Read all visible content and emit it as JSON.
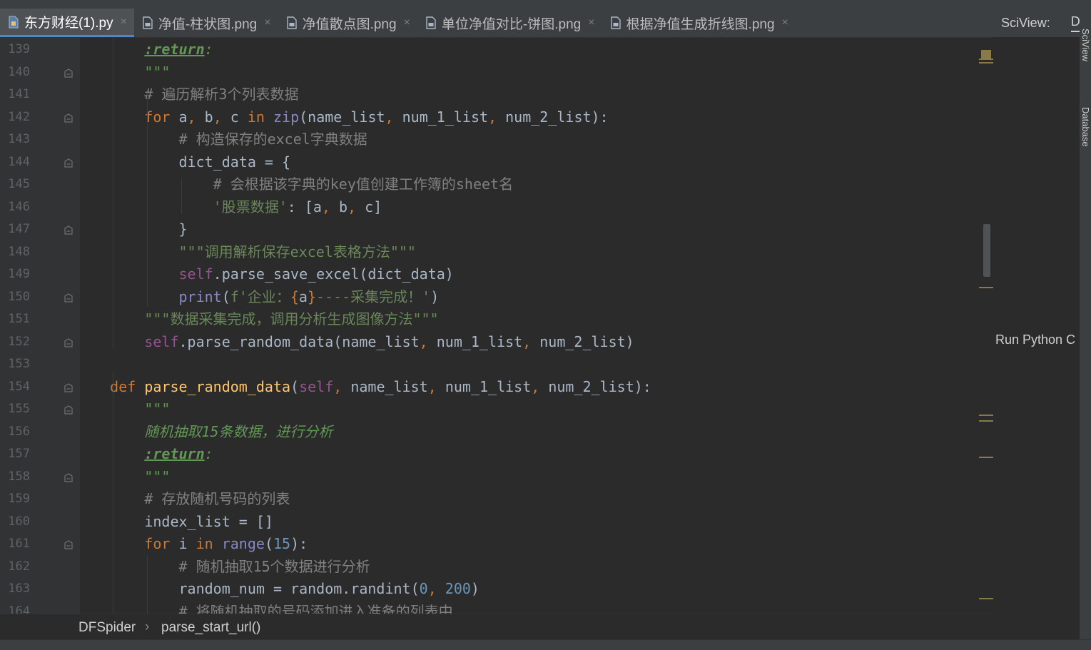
{
  "tabs": [
    {
      "label": "东方财经(1).py",
      "icon": "python-file-icon",
      "active": true
    },
    {
      "label": "净值-柱状图.png",
      "icon": "image-file-icon",
      "active": false
    },
    {
      "label": "净值散点图.png",
      "icon": "image-file-icon",
      "active": false
    },
    {
      "label": "单位净值对比-饼图.png",
      "icon": "image-file-icon",
      "active": false
    },
    {
      "label": "根据净值生成折线图.png",
      "icon": "image-file-icon",
      "active": false
    }
  ],
  "tab_close_glyph": "×",
  "sciview": {
    "title": "SciView:",
    "tab": "D",
    "run_label": "Run Python C"
  },
  "side_tools": [
    "SciView",
    "Database"
  ],
  "line_numbers": [
    "139",
    "140",
    "141",
    "142",
    "143",
    "144",
    "145",
    "146",
    "147",
    "148",
    "149",
    "150",
    "151",
    "152",
    "153",
    "154",
    "155",
    "156",
    "157",
    "158",
    "159",
    "160",
    "161",
    "162",
    "163",
    "164"
  ],
  "code_lines": [
    {
      "t": [
        [
          "        ",
          ""
        ],
        [
          ":return",
          ""
        ],
        [
          ":",
          ""
        ]
      ],
      "raw": "        :return:"
    },
    {
      "raw": "        \"\"\""
    },
    {
      "raw": "        # 遍历解析3个列表数据"
    },
    {
      "raw": "        for a, b, c in zip(name_list, num_1_list, num_2_list):"
    },
    {
      "raw": "            # 构造保存的excel字典数据"
    },
    {
      "raw": "            dict_data = {"
    },
    {
      "raw": "                # 会根据该字典的key值创建工作簿的sheet名"
    },
    {
      "raw": "                '股票数据': [a, b, c]"
    },
    {
      "raw": "            }"
    },
    {
      "raw": "            \"\"\"调用解析保存excel表格方法\"\"\""
    },
    {
      "raw": "            self.parse_save_excel(dict_data)"
    },
    {
      "raw": "            print(f'企业：{a}----采集完成！')"
    },
    {
      "raw": "        \"\"\"数据采集完成，调用分析生成图像方法\"\"\""
    },
    {
      "raw": "        self.parse_random_data(name_list, num_1_list, num_2_list)"
    },
    {
      "raw": ""
    },
    {
      "raw": "    def parse_random_data(self, name_list, num_1_list, num_2_list):"
    },
    {
      "raw": "        \"\"\""
    },
    {
      "raw": "        随机抽取15条数据，进行分析"
    },
    {
      "raw": "        :return:"
    },
    {
      "raw": "        \"\"\""
    },
    {
      "raw": "        # 存放随机号码的列表"
    },
    {
      "raw": "        index_list = []"
    },
    {
      "raw": "        for i in range(15):"
    },
    {
      "raw": "            # 随机抽取15个数据进行分析"
    },
    {
      "raw": "            random_num = random.randint(0, 200)"
    },
    {
      "raw": "            # 将随机抽取的号码添加进入准备的列表中"
    }
  ],
  "breadcrumb": {
    "class_name": "DFSpider",
    "separator": "›",
    "method": "parse_start_url()"
  },
  "colors": {
    "keyword": "#cc7832",
    "comment": "#808080",
    "string": "#6a8759",
    "function": "#ffc66d",
    "number": "#6897bb",
    "self": "#94558d",
    "builtin": "#8888c6",
    "accent": "#4a88c7"
  }
}
